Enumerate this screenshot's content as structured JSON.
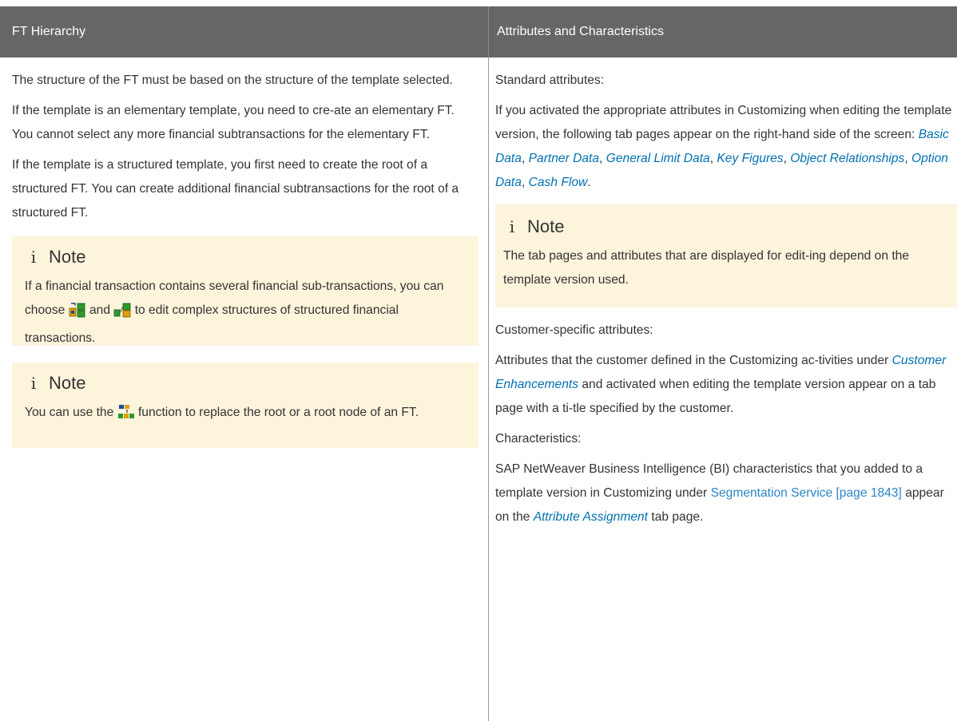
{
  "headers": {
    "col1": "FT Hierarchy",
    "col2": "Attributes and Characteristics"
  },
  "left": {
    "p1": "The structure of the FT must be based on the structure of the template selected.",
    "p2": "If the template is an elementary template, you need to cre-ate an elementary FT. You cannot select any more financial subtransactions for the elementary FT.",
    "p3": "If the template is a structured template, you first need to create the root of a structured FT. You can create additional financial subtransactions for the root of a structured FT.",
    "note1": {
      "icon": "i",
      "title": "Note",
      "text_before": "If a financial transaction contains several financial sub-transactions, you can choose",
      "text_mid": "and",
      "text_after": "to edit complex structures of structured financial transactions."
    },
    "note2": {
      "icon": "i",
      "title": "Note",
      "text_before": "You can use the",
      "text_after": "function to replace the root or a root node of an FT."
    }
  },
  "right": {
    "std_label": "Standard attributes:",
    "std_text": "If you activated the appropriate attributes in Customizing when editing the template version, the following tab pages appear on the right-hand side of the screen:",
    "tabs": [
      "Basic Data",
      "Partner Data",
      "General Limit Data",
      "Key Figures",
      "Object Relationships",
      "Option Data",
      "Cash Flow"
    ],
    "note": {
      "icon": "i",
      "title": "Note",
      "text": "The tab pages and attributes that are displayed for edit-ing depend on the template version used."
    },
    "cust_label": "Customer-specific attributes:",
    "cust_text_before": "Attributes that the customer defined in the Customizing ac-tivities under",
    "cust_link": "Customer Enhancements",
    "cust_text_after": "and activated when editing the template version appear on a tab page with a ti-tle specified by the customer.",
    "char_label": "Characteristics:",
    "char_text_before": "SAP NetWeaver Business Intelligence (BI) characteristics that you added to a template version in Customizing under",
    "char_xref": "Segmentation Service [page 1843]",
    "char_text_mid": "appear on the",
    "char_link": "Attribute Assignment",
    "char_text_after": "tab page."
  },
  "colors": {
    "header_bg": "#666666",
    "note_bg": "#fdf4dc",
    "link": "#0070b0"
  }
}
